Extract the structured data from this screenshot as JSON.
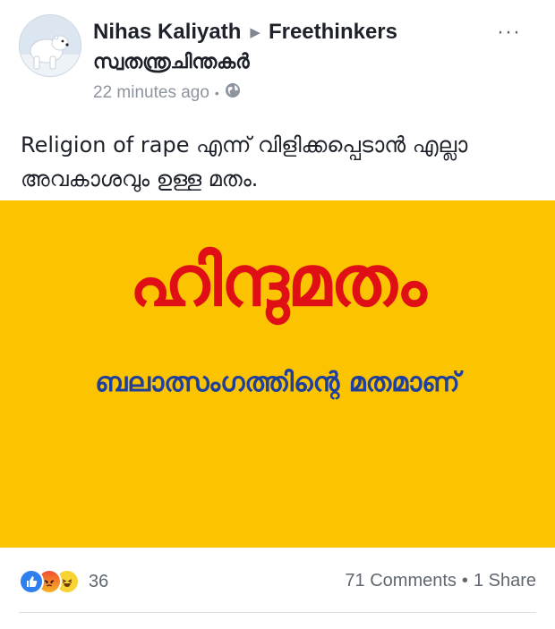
{
  "post": {
    "author": "Nihas Kaliyath",
    "group": "Freethinkers",
    "group_malayalam": "സ്വതന്ത്രചിന്തകർ",
    "timestamp": "22 minutes ago",
    "text": "Religion of rape എന്ന് വിളിക്കപ്പെടാൻ എല്ലാ അവകാശവും ഉള്ള മതം."
  },
  "image": {
    "headline": "ഹിന്ദുമതം",
    "subline": "ബലാത്സംഗത്തിന്റെ മതമാണ്",
    "background_color": "#fcc400",
    "headline_color": "#e00f16",
    "subline_color": "#1f3f9c"
  },
  "footer": {
    "reaction_count": "36",
    "reactions": [
      "like-icon",
      "angry-icon",
      "haha-icon"
    ],
    "comments": "71 Comments",
    "separator": "•",
    "shares": "1 Share"
  },
  "icons": {
    "more": "more-options-icon",
    "privacy": "globe-icon"
  }
}
